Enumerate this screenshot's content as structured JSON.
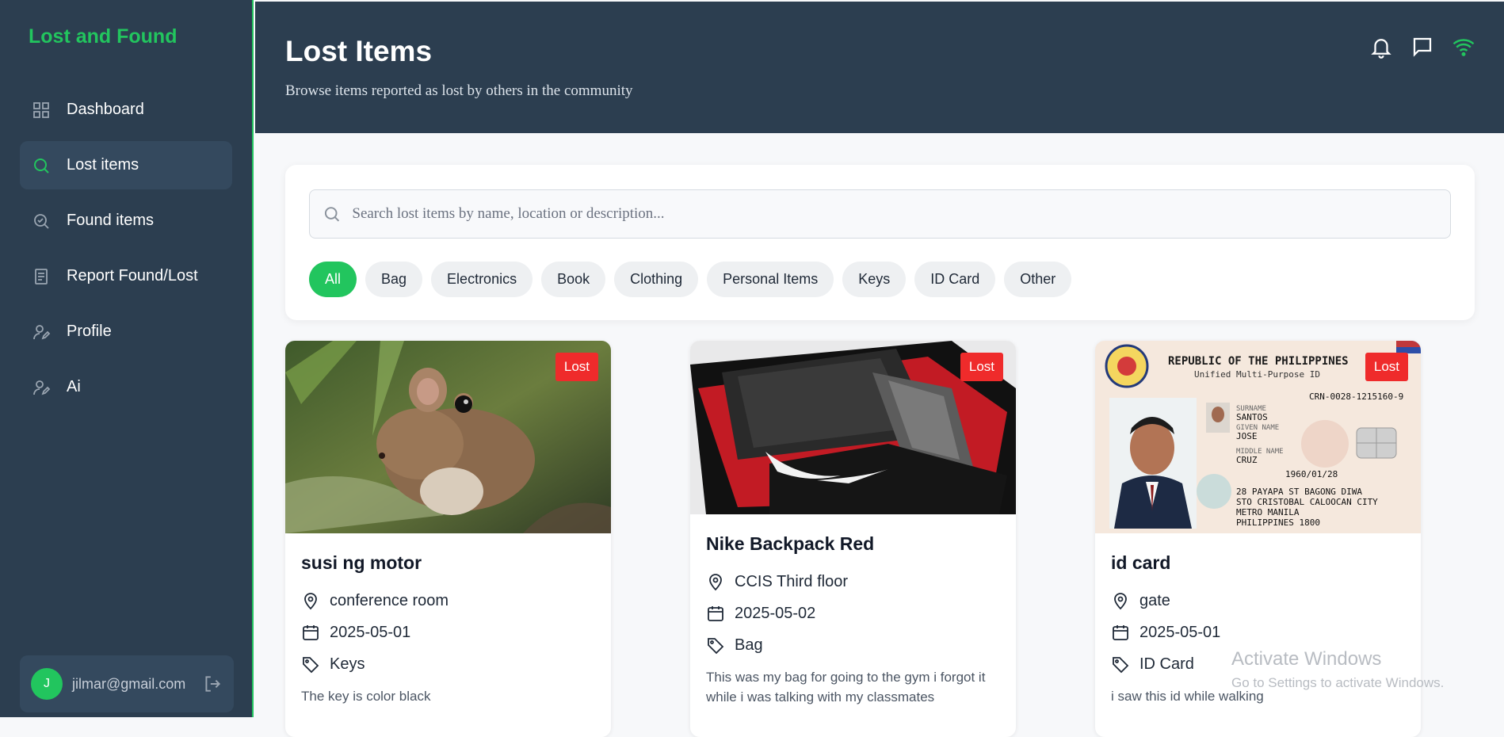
{
  "sidebar": {
    "brand": "Lost and Found",
    "items": [
      {
        "label": "Dashboard",
        "icon": "grid-icon"
      },
      {
        "label": "Lost items",
        "icon": "search-icon",
        "active": true
      },
      {
        "label": "Found items",
        "icon": "search-check-icon"
      },
      {
        "label": "Report Found/Lost",
        "icon": "document-icon"
      },
      {
        "label": "Profile",
        "icon": "user-edit-icon"
      },
      {
        "label": "Ai",
        "icon": "user-edit-icon"
      }
    ],
    "user": {
      "initial": "J",
      "email": "jilmar@gmail.com"
    }
  },
  "header": {
    "title": "Lost Items",
    "subtitle": "Browse items reported as lost by others in the community",
    "icons": [
      "bell-icon",
      "message-icon",
      "wifi-icon"
    ]
  },
  "search": {
    "placeholder": "Search lost items by name, location or description..."
  },
  "filters": [
    "All",
    "Bag",
    "Electronics",
    "Book",
    "Clothing",
    "Personal Items",
    "Keys",
    "ID Card",
    "Other"
  ],
  "cards": [
    {
      "badge": "Lost",
      "title": "susi ng motor",
      "location": "conference room",
      "date": "2025-05-01",
      "category": "Keys",
      "description": "The key is color black"
    },
    {
      "badge": "Lost",
      "title": "Nike Backpack Red",
      "location": "CCIS Third floor",
      "date": "2025-05-02",
      "category": "Bag",
      "description": "This was my bag for going to the gym i forgot it while i was talking with my classmates"
    },
    {
      "badge": "Lost",
      "title": "id card",
      "location": "gate",
      "date": "2025-05-01",
      "category": "ID Card",
      "description": "i saw this id while walking"
    }
  ],
  "id_card_text": {
    "country": "REPUBLIC OF THE PHILIPPINES",
    "subtitle": "Unified Multi-Purpose ID",
    "crn": "CRN-0028-1215160-9",
    "surname": "SANTOS",
    "given": "JOSE",
    "middle": "CRUZ",
    "dob": "1960/01/28",
    "addr1": "28 PAYAPA ST BAGONG DIWA",
    "addr2": "STO CRISTOBAL CALOOCAN CITY",
    "addr3": "METRO MANILA",
    "addr4": "PHILIPPINES 1800"
  },
  "watermark": {
    "line1": "Activate Windows",
    "line2": "Go to Settings to activate Windows."
  },
  "colors": {
    "accent": "#22c55e",
    "sidebar": "#2c3e50",
    "badge": "#ef2b2b"
  }
}
